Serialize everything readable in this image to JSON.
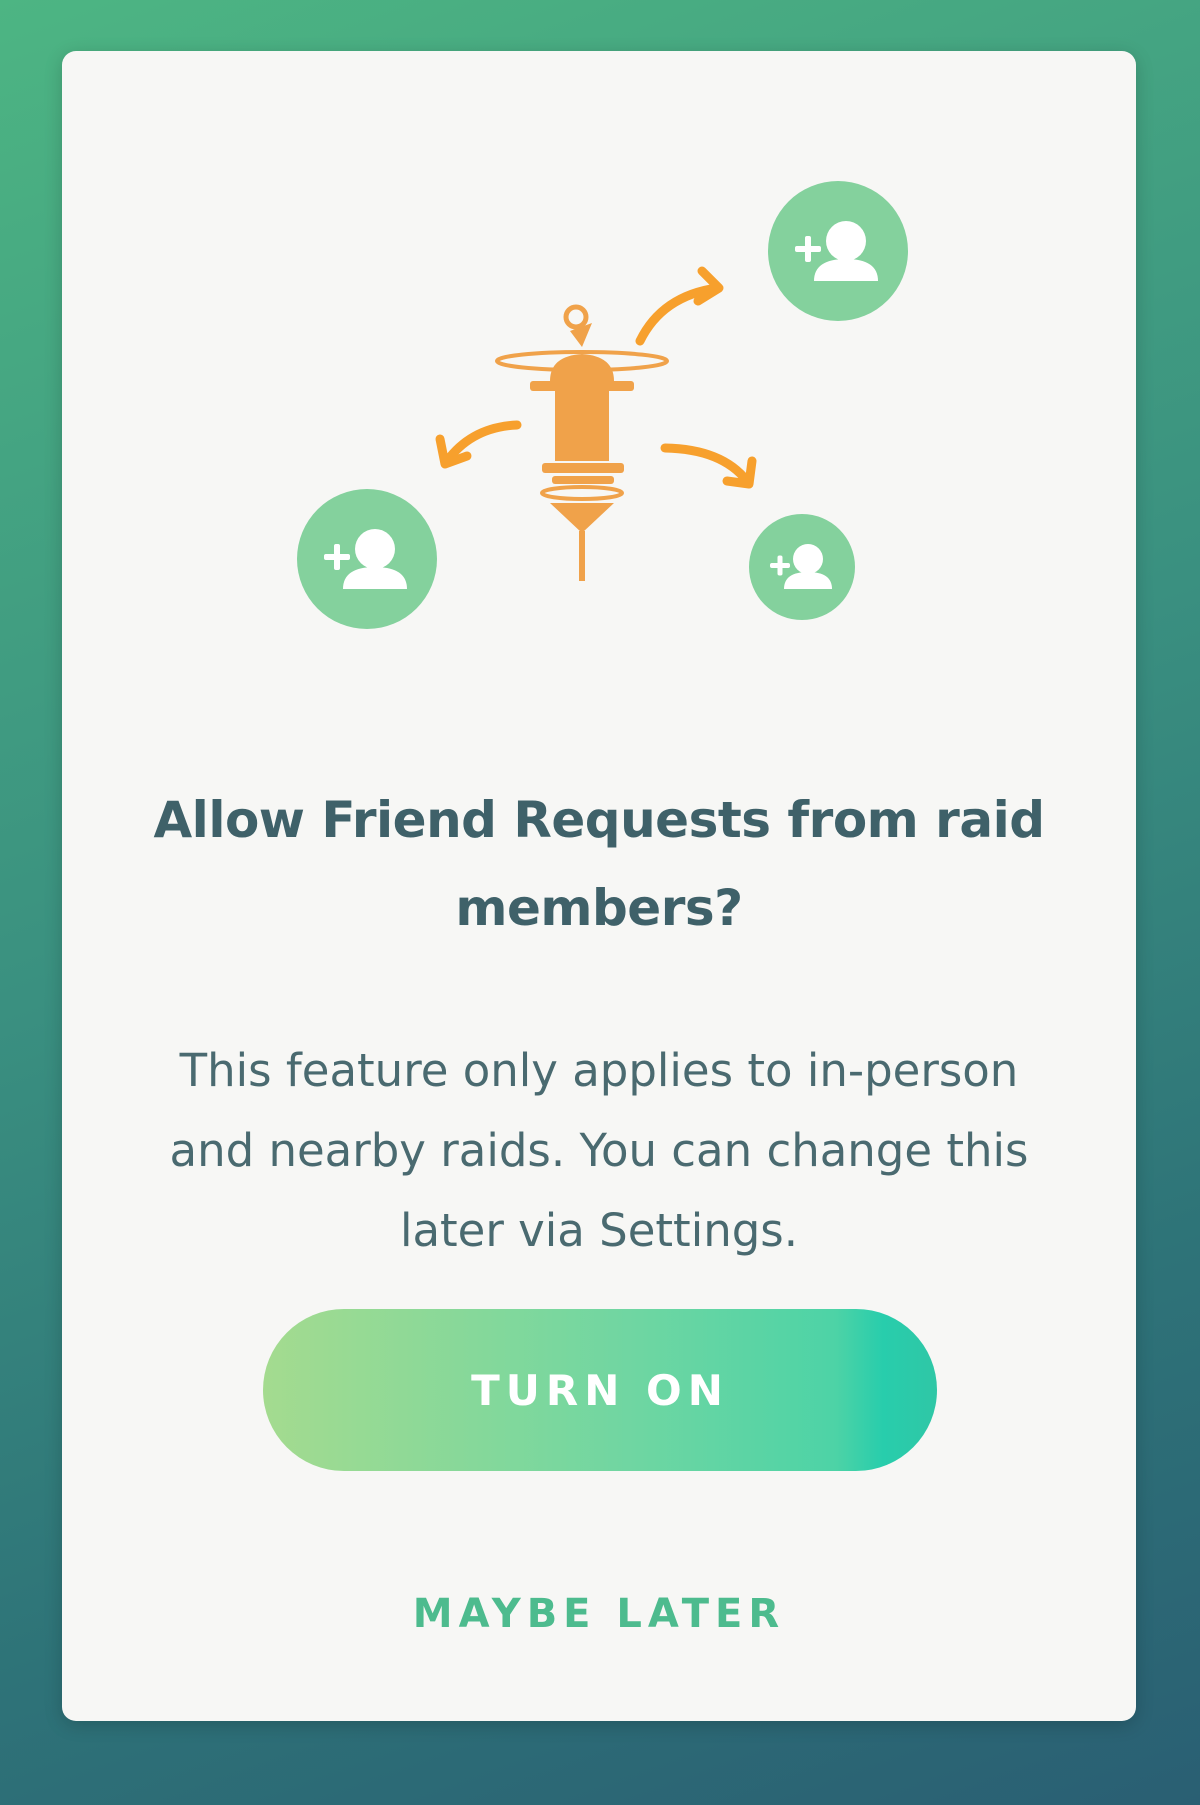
{
  "dialog": {
    "title": "Allow Friend Requests from raid members?",
    "description": "This feature only applies to in-person and nearby raids. You can change this later via Settings.",
    "primary_button_label": "TURN ON",
    "secondary_button_label": "MAYBE LATER"
  },
  "illustration": {
    "icons": [
      "pokestop-icon",
      "add-friend-icon",
      "arrow-icon"
    ]
  },
  "colors": {
    "background_top": "#4db583",
    "background_bottom": "#2a5f73",
    "card": "#f7f7f5",
    "title_text": "#3f6169",
    "body_text": "#4a6a70",
    "accent_orange": "#f0a24a",
    "accent_green": "#84d19d",
    "button_gradient_start": "#a4db8f",
    "button_gradient_end": "#28cdac",
    "link_text": "#4dbb8e"
  }
}
